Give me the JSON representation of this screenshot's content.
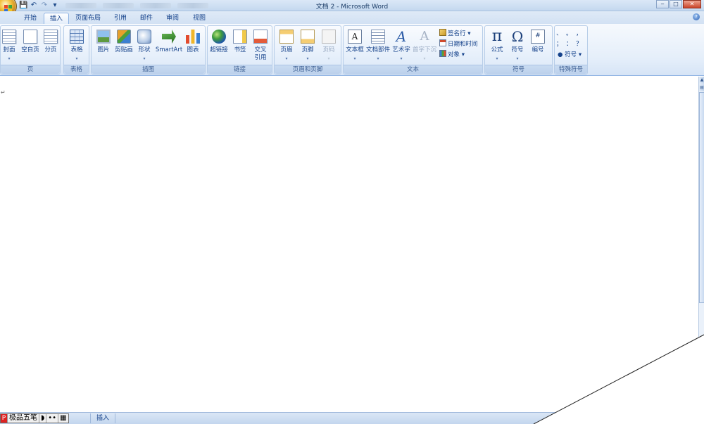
{
  "window": {
    "title": "文档 2 - Microsoft Word",
    "controls": {
      "minimize": "‒",
      "maximize": "□",
      "close": "✕"
    }
  },
  "quick_access": {
    "save": "💾",
    "undo": "↶",
    "redo": "↷",
    "customize": "▾"
  },
  "tabs": [
    {
      "label": "开始",
      "active": false
    },
    {
      "label": "插入",
      "active": true
    },
    {
      "label": "页面布局",
      "active": false
    },
    {
      "label": "引用",
      "active": false
    },
    {
      "label": "邮件",
      "active": false
    },
    {
      "label": "审阅",
      "active": false
    },
    {
      "label": "视图",
      "active": false
    }
  ],
  "ribbon": {
    "groups": {
      "pages": {
        "label": "页",
        "buttons": [
          "封面",
          "空白页",
          "分页"
        ]
      },
      "tables": {
        "label": "表格",
        "buttons": [
          "表格"
        ]
      },
      "illustrations": {
        "label": "插图",
        "buttons": [
          "图片",
          "剪贴画",
          "形状",
          "SmartArt",
          "图表"
        ]
      },
      "links": {
        "label": "链接",
        "buttons": [
          "超链接",
          "书签",
          "交叉\n引用"
        ]
      },
      "header_footer": {
        "label": "页眉和页脚",
        "buttons": [
          "页眉",
          "页脚",
          "页码"
        ]
      },
      "text": {
        "label": "文本",
        "buttons": [
          "文本框",
          "文档部件",
          "艺术字",
          "首字下沉"
        ],
        "small": [
          "签名行",
          "日期和时间",
          "对象"
        ]
      },
      "symbols": {
        "label": "符号",
        "buttons": [
          "公式",
          "符号",
          "编号"
        ]
      },
      "special": {
        "label": "特殊符号",
        "chars": [
          "、",
          "。",
          "，",
          "；",
          "：",
          "？"
        ],
        "more": "符号"
      }
    },
    "glyphs": {
      "text_box": "A",
      "word_art": "A",
      "drop_cap": "A",
      "pi": "π",
      "omega": "Ω",
      "number": "#",
      "dropdown": "▾"
    }
  },
  "document": {
    "paragraph_mark": "↵"
  },
  "statusbar": {
    "ime": {
      "logo": "P",
      "name": "极品五笔",
      "moon": "◗",
      "dots": "••",
      "keyboard": "▦"
    },
    "mode": "插入"
  },
  "colors": {
    "ribbon_text": "#15428b",
    "ribbon_border": "#8db2e3",
    "status_bg": "#c3d6ee"
  }
}
